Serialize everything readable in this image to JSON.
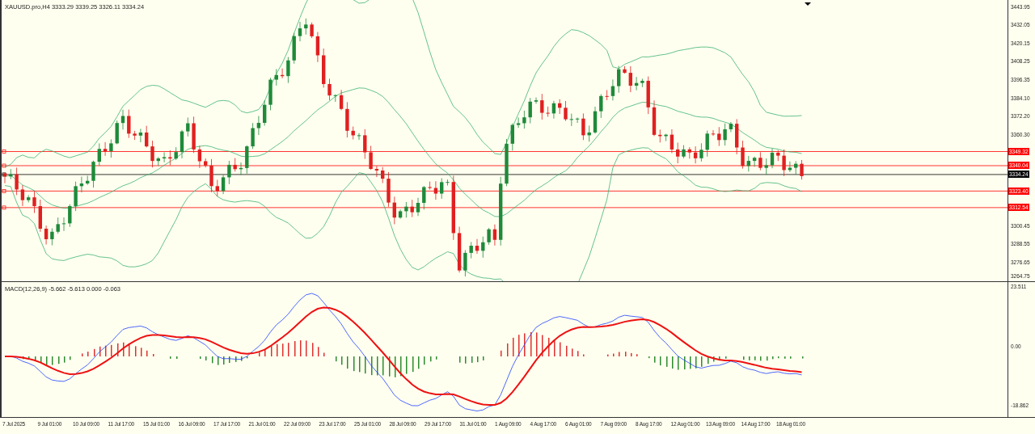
{
  "chart": {
    "title": "XAUUSD.pro,H4  3333.29 3339.25 3326.11 3334.24"
  },
  "price_axis": {
    "labels": [
      "3443.95",
      "3432.05",
      "3420.15",
      "3408.25",
      "3396.35",
      "3384.10",
      "3372.20",
      "3360.30",
      "3300.45",
      "3288.55",
      "3276.65",
      "3264.75"
    ]
  },
  "price_lines": [
    {
      "label": "3349.32",
      "color": "#ff0000"
    },
    {
      "label": "3340.04",
      "color": "#ff0000"
    },
    {
      "label": "3334.24",
      "color": "#000000"
    },
    {
      "label": "3323.40",
      "color": "#ff0000"
    },
    {
      "label": "3312.54",
      "color": "#ff0000"
    }
  ],
  "macd": {
    "title": "MACD(12,26,9) -5.662 -5.613 0.000 -0.063",
    "axis_labels": [
      "23.511",
      "0.00",
      "-18.862"
    ]
  },
  "time_axis": {
    "labels": [
      "7 Jul 2025",
      "9 Jul 01:00",
      "10 Jul 09:00",
      "11 Jul 17:00",
      "15 Jul 01:00",
      "16 Jul 09:00",
      "17 Jul 17:00",
      "21 Jul 01:00",
      "22 Jul 09:00",
      "23 Jul 17:00",
      "25 Jul 01:00",
      "28 Jul 09:00",
      "29 Jul 17:00",
      "31 Jul 01:00",
      "1 Aug 09:00",
      "4 Aug 17:00",
      "6 Aug 01:00",
      "7 Aug 09:00",
      "8 Aug 17:00",
      "12 Aug 01:00",
      "13 Aug 09:00",
      "14 Aug 17:00",
      "18 Aug 01:00"
    ]
  }
}
